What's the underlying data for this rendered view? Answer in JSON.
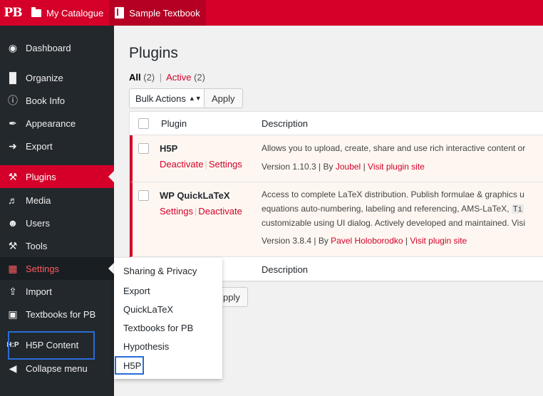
{
  "topbar": {
    "logo": "PB",
    "catalogue": "My Catalogue",
    "book": "Sample Textbook"
  },
  "sidebar": {
    "items": [
      {
        "label": "Dashboard",
        "icon": "dashboard-icon"
      },
      {
        "label": "Organize",
        "icon": "book-icon"
      },
      {
        "label": "Book Info",
        "icon": "info-icon"
      },
      {
        "label": "Appearance",
        "icon": "paint-brush-icon"
      },
      {
        "label": "Export",
        "icon": "export-icon"
      },
      {
        "label": "Plugins",
        "icon": "plugins-icon"
      },
      {
        "label": "Media",
        "icon": "media-icon"
      },
      {
        "label": "Users",
        "icon": "users-icon"
      },
      {
        "label": "Tools",
        "icon": "tools-icon"
      },
      {
        "label": "Settings",
        "icon": "settings-icon"
      },
      {
        "label": "Import",
        "icon": "import-icon"
      },
      {
        "label": "Textbooks for PB",
        "icon": "textbooks-icon"
      },
      {
        "label": "H5P Content",
        "icon": "h5p-icon"
      },
      {
        "label": "Collapse menu",
        "icon": "collapse-icon"
      }
    ]
  },
  "flyout": {
    "items": [
      "Sharing & Privacy",
      "Export",
      "QuickLaTeX",
      "Textbooks for PB",
      "Hypothesis",
      "H5P"
    ]
  },
  "main": {
    "title": "Plugins",
    "filter_all": "All",
    "filter_all_count": "(2)",
    "filter_active": "Active",
    "filter_active_count": "(2)",
    "bulk_label": "Bulk Actions",
    "apply_label": "Apply",
    "apply_bottom_partial": "pply",
    "col_plugin": "Plugin",
    "col_description": "Description"
  },
  "plugins": [
    {
      "name": "H5P",
      "action1": "Deactivate",
      "action2": "Settings",
      "desc_line1": "Allows you to upload, create, share and use rich interactive content or",
      "version": "Version 1.10.3 | By ",
      "author": "Joubel",
      "site": "Visit plugin site"
    },
    {
      "name": "WP QuickLaTeX",
      "action1": "Settings",
      "action2": "Deactivate",
      "desc_line1": "Access to complete LaTeX distribution. Publish formulae & graphics u",
      "desc_line2_a": "equations auto-numbering, labeling and referencing, AMS-LaTeX,",
      "desc_line2_code": "Ti",
      "desc_line3": "customizable using UI dialog. Actively developed and maintained. Visi",
      "version": "Version 3.8.4 | By ",
      "author": "Pavel Holoborodko",
      "site": "Visit plugin site"
    }
  ],
  "colors": {
    "brand_red": "#d4002a",
    "sidebar_bg": "#23282d",
    "highlight_blue": "#2a6cd6"
  }
}
